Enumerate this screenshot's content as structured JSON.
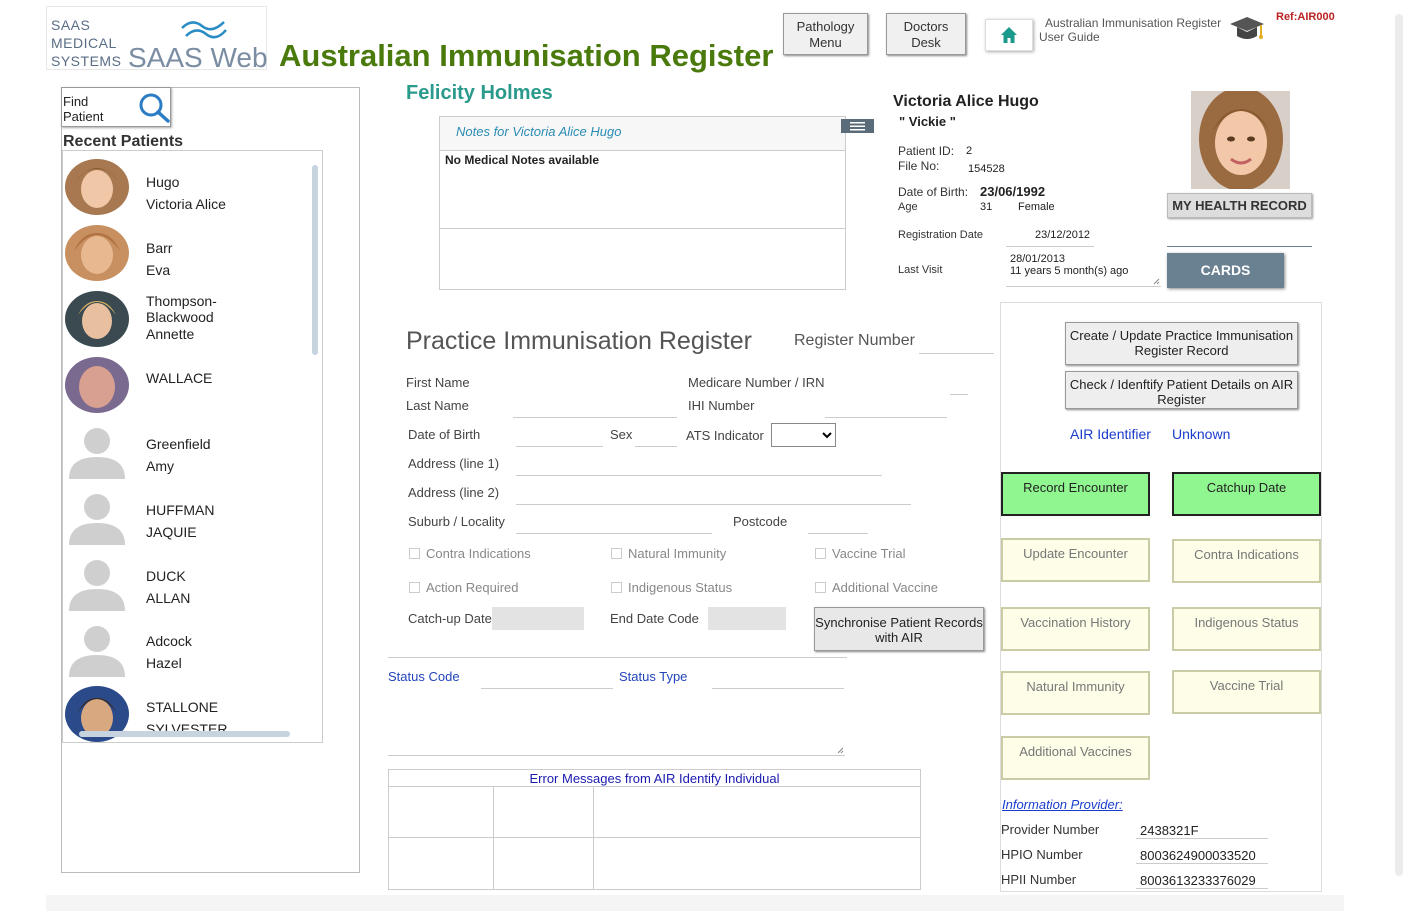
{
  "brand": {
    "line1": "SAAS",
    "line2": "MEDICAL",
    "line3": "SYSTEMS",
    "web": "SAAS Web"
  },
  "header": {
    "title": "Australian Immunisation Register"
  },
  "top_buttons": {
    "pathology": "Pathology Menu",
    "doctors": "Doctors Desk"
  },
  "guide": {
    "line1": "Australian Immunisation Register",
    "line2": "User Guide"
  },
  "ref": "Ref:AIR000",
  "sidebar": {
    "find_label": "Find Patient",
    "recent_title": "Recent Patients",
    "patients": [
      {
        "line1": "Hugo",
        "line2": "Victoria Alice"
      },
      {
        "line1": "Barr",
        "line2": "Eva"
      },
      {
        "line1": "Thompson-",
        "line2": "Blackwood",
        "line3": "Annette"
      },
      {
        "line1": "WALLACE",
        "line2": ""
      },
      {
        "line1": "Greenfield",
        "line2": "Amy"
      },
      {
        "line1": "HUFFMAN",
        "line2": "JAQUIE"
      },
      {
        "line1": "DUCK",
        "line2": "ALLAN"
      },
      {
        "line1": "Adcock",
        "line2": "Hazel"
      },
      {
        "line1": "STALLONE",
        "line2": "SYLVESTER"
      }
    ]
  },
  "user_name": "Felicity Holmes",
  "notes": {
    "title": "Notes for Victoria Alice Hugo",
    "body": "No Medical Notes available"
  },
  "patient": {
    "full_name": "Victoria Alice Hugo",
    "nickname": "\" Vickie \"",
    "patient_id_label": "Patient ID:",
    "patient_id": "2",
    "file_no_label": "File No:",
    "file_no": "154528",
    "dob_label": "Date of Birth:",
    "dob": "23/06/1992",
    "age_label": "Age",
    "age": "31",
    "sex": "Female",
    "reg_date_label": "Registration Date",
    "reg_date": "23/12/2012",
    "last_visit_label": "Last Visit",
    "last_visit_date": "28/01/2013",
    "last_visit_ago": "11 years 5 month(s) ago"
  },
  "buttons": {
    "health_record": "MY HEALTH RECORD",
    "cards": "CARDS"
  },
  "register": {
    "title": "Practice Immunisation Register",
    "register_number_label": "Register Number",
    "first_name": "First Name",
    "last_name": "Last Name",
    "medicare": "Medicare Number / IRN",
    "ihi": "IHI Number",
    "dob": "Date of Birth",
    "sex": "Sex",
    "ats": "ATS Indicator",
    "addr1": "Address (line 1)",
    "addr2": "Address (line 2)",
    "suburb": "Suburb / Locality",
    "postcode": "Postcode",
    "checks": {
      "contra": "Contra Indications",
      "natural": "Natural Immunity",
      "vaccine_trial": "Vaccine Trial",
      "action": "Action Required",
      "indigenous": "Indigenous Status",
      "additional": "Additional Vaccine"
    },
    "catchup": "Catch-up Date",
    "end_date_code": "End Date Code",
    "sync": "Synchronise Patient Records with AIR",
    "status_code": "Status Code",
    "status_type": "Status Type",
    "error_title": "Error Messages from AIR Identify Individual"
  },
  "right": {
    "create_update": "Create / Update Practice Immunisation Register Record",
    "check_identify": "Check / Idenftify Patient Details on AIR Register",
    "air_identifier_label": "AIR Identifier",
    "air_identifier_value": "Unknown",
    "record_encounter": "Record Encounter",
    "catchup_date": "Catchup Date",
    "update_encounter": "Update Encounter",
    "contra": "Contra Indications",
    "vacc_history": "Vaccination History",
    "indigenous": "Indigenous Status",
    "natural": "Natural Immunity",
    "vaccine_trial": "Vaccine Trial",
    "additional": "Additional Vaccines",
    "info_provider": "Information Provider:",
    "provider_number_label": "Provider Number",
    "provider_number": "2438321F",
    "hpio_label": "HPIO Number",
    "hpio": "8003624900033520",
    "hpii_label": "HPII Number",
    "hpii": "8003613233376029"
  },
  "colors": {
    "brand_green": "#4a7a0c",
    "teal": "#2a9a8c",
    "link_blue": "#1a3ccc",
    "green_btn": "#90f690",
    "cards_bg": "#6a8192"
  }
}
